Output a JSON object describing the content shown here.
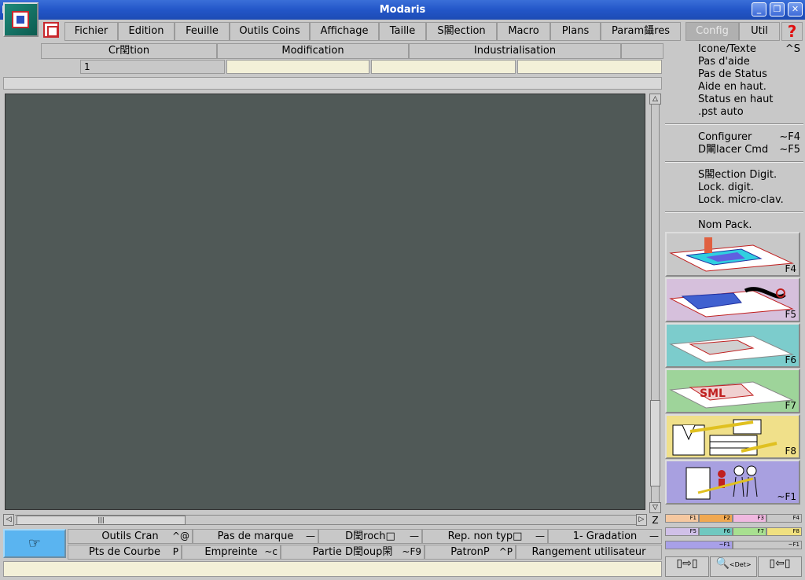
{
  "window": {
    "title": "Modaris"
  },
  "menu": {
    "items": [
      "Fichier",
      "Edition",
      "Feuille",
      "Outils Coins",
      "Affichage",
      "Taille",
      "S閣ection",
      "Macro",
      "Plans",
      "Param鑷res",
      "Config",
      "Util"
    ]
  },
  "tabs": [
    "Cr閏tion",
    "Modification",
    "Industrialisation"
  ],
  "fields": [
    "1",
    "",
    "",
    ""
  ],
  "config_menu": {
    "items": [
      {
        "label": "Icone/Texte",
        "shortcut": "^S"
      },
      {
        "label": "Pas d'aide",
        "shortcut": ""
      },
      {
        "label": "Pas de Status",
        "shortcut": ""
      },
      {
        "label": "Aide en haut.",
        "shortcut": ""
      },
      {
        "label": "Status en haut",
        "shortcut": ""
      },
      {
        "label": ".pst auto",
        "shortcut": ""
      },
      {
        "label": "Configurer",
        "shortcut": "~F4"
      },
      {
        "label": "D閳lacer Cmd",
        "shortcut": "~F5"
      },
      {
        "label": "S閣ection Digit.",
        "shortcut": ""
      },
      {
        "label": "Lock. digit.",
        "shortcut": ""
      },
      {
        "label": "Lock. micro-clav.",
        "shortcut": ""
      },
      {
        "label": "Nom Pack.",
        "shortcut": ""
      }
    ]
  },
  "modules": [
    {
      "key": "F4",
      "bg": "#c8c8c8"
    },
    {
      "key": "F5",
      "bg": "#d6c0dc"
    },
    {
      "key": "F6",
      "bg": "#7ccccc"
    },
    {
      "key": "F7",
      "bg": "#9ed49a"
    },
    {
      "key": "F8",
      "bg": "#f0e08a"
    },
    {
      "key": "~F1",
      "bg": "#a8a0e0"
    }
  ],
  "chips": [
    {
      "label": "F1",
      "color": "#f5c8a0"
    },
    {
      "label": "F2",
      "color": "#f0a850"
    },
    {
      "label": "F3",
      "color": "#f0b8e0"
    },
    {
      "label": "F4",
      "color": "#c8c8c8"
    },
    {
      "label": "F5",
      "color": "#d0c0e8"
    },
    {
      "label": "F6",
      "color": "#70c8c0"
    },
    {
      "label": "F7",
      "color": "#a8e090"
    },
    {
      "label": "F8",
      "color": "#f0e080"
    },
    {
      "label": "~F1",
      "color": "#a8a0e8"
    },
    {
      "label": "~F1",
      "color": "#c8c8c8"
    }
  ],
  "scroll": {
    "z_label": "Z"
  },
  "commands": {
    "row1": [
      {
        "label": "Outils Cran",
        "shortcut": "^@"
      },
      {
        "label": "Pas de marque",
        "shortcut": "—"
      },
      {
        "label": "D閏roch□",
        "shortcut": "—"
      },
      {
        "label": "Rep. non typ□",
        "shortcut": "—"
      },
      {
        "label": "1- Gradation",
        "shortcut": "—"
      }
    ],
    "row2": [
      {
        "label": "Pts de Courbe",
        "shortcut": "P"
      },
      {
        "label": "Empreinte",
        "shortcut": "~c"
      },
      {
        "label": "Partie D閏oup閑",
        "shortcut": "~F9"
      },
      {
        "label": "PatronP",
        "shortcut": "^P"
      },
      {
        "label": "Rangement utilisateur",
        "shortcut": ""
      }
    ]
  },
  "bottom_buttons": [
    "<Det>"
  ],
  "status": {
    "text": ""
  }
}
